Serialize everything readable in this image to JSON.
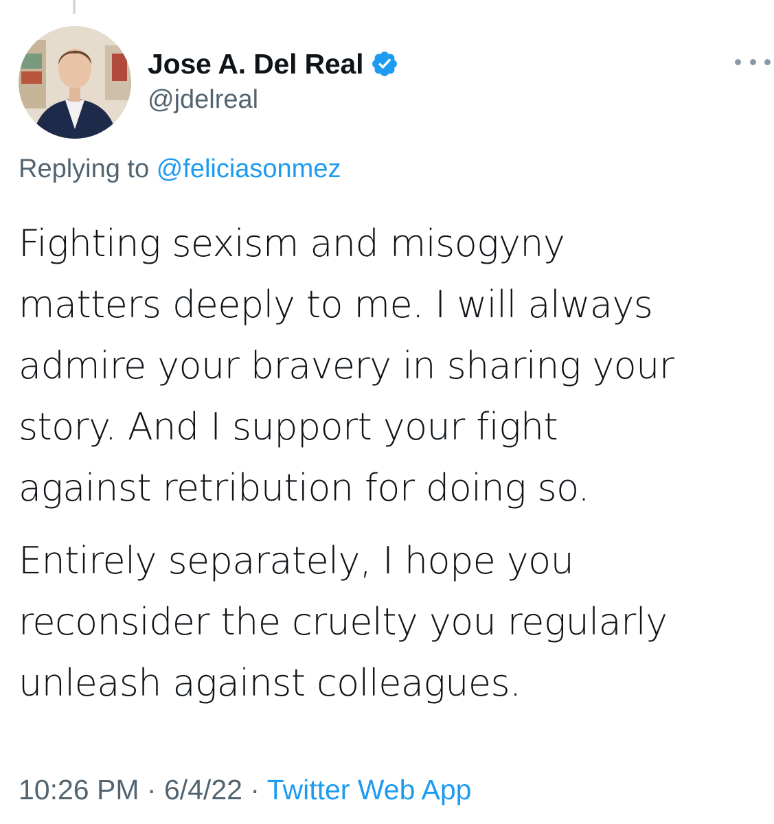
{
  "tweet": {
    "author": {
      "display_name": "Jose A. Del Real",
      "handle": "@jdelreal",
      "verified": true,
      "avatar_icon": "person-avatar"
    },
    "reply": {
      "prefix": "Replying to",
      "mention": "@feliciasonmez"
    },
    "paragraphs": [
      "Fighting sexism and misogyny\nmatters deeply to me. I will always\nadmire your bravery in sharing your\nstory.  And I support your fight\nagainst retribution for doing so.",
      "Entirely separately, I hope you\nreconsider the cruelty you regularly\nunleash against colleagues."
    ],
    "time": "10:26 PM",
    "date": "6/4/22",
    "separator": "·",
    "source": "Twitter Web App"
  },
  "icons": {
    "verified": "verified-badge-icon",
    "more": "more-options-icon"
  },
  "colors": {
    "link": "#1d9bf0",
    "secondary_text": "#536471",
    "primary_text": "#0f1419",
    "verified": "#1d9bf0"
  }
}
